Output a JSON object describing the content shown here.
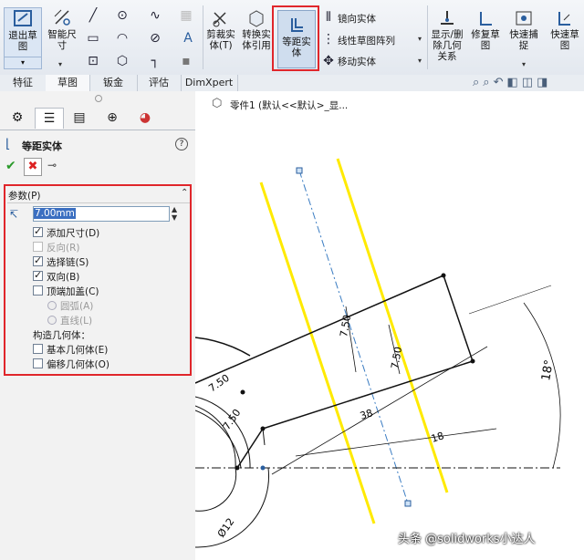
{
  "ribbon": {
    "exit_sketch": [
      "退出草",
      "图"
    ],
    "smart_dim": [
      "智能尺",
      "寸"
    ],
    "trim": [
      "剪裁实",
      "体(T)"
    ],
    "convert": [
      "转换实",
      "体引用"
    ],
    "offset": [
      "等距实",
      "体"
    ],
    "mirror": "镜向实体",
    "linear_pattern": "线性草图阵列",
    "move": "移动实体",
    "show_delete": [
      "显示/删",
      "除几何",
      "关系"
    ],
    "repair": [
      "修复草",
      "图"
    ],
    "quick_snap": [
      "快速捕",
      "捉"
    ],
    "quick_view": [
      "快速草",
      "图"
    ],
    "text_glyph": "A"
  },
  "tabs": [
    "特征",
    "草图",
    "钣金",
    "评估",
    "DimXpert"
  ],
  "tree": {
    "label": "零件1 (默认<<默认>_显..."
  },
  "panel": {
    "title": "等距实体",
    "section": "参数(P)",
    "distance": "7.00mm",
    "opt_add_dim": "添加尺寸(D)",
    "opt_reverse": "反向(R)",
    "opt_select_chain": "选择链(S)",
    "opt_bidirectional": "双向(B)",
    "opt_cap_ends": "顶端加盖(C)",
    "opt_arcs": "圆弧(A)",
    "opt_lines": "直线(L)",
    "construction_label": "构造几何体：",
    "opt_base_geom": "基本几何体(E)",
    "opt_offset_geom": "偏移几何体(O)",
    "states": {
      "add_dim": true,
      "reverse": false,
      "select_chain": true,
      "bidirectional": true,
      "cap_ends": false,
      "base_geom": false,
      "offset_geom": false
    }
  },
  "drawing": {
    "dim_750": "7.50",
    "dim_38": "38",
    "dim_18": "18",
    "dim_angle": "18°",
    "dim_dia": "Ø12"
  },
  "watermark": "头条 @solidworks小达人",
  "colors": {
    "highlight": "#e0262b",
    "offset_line": "#ffea00",
    "centerline": "#3a7cc2"
  }
}
